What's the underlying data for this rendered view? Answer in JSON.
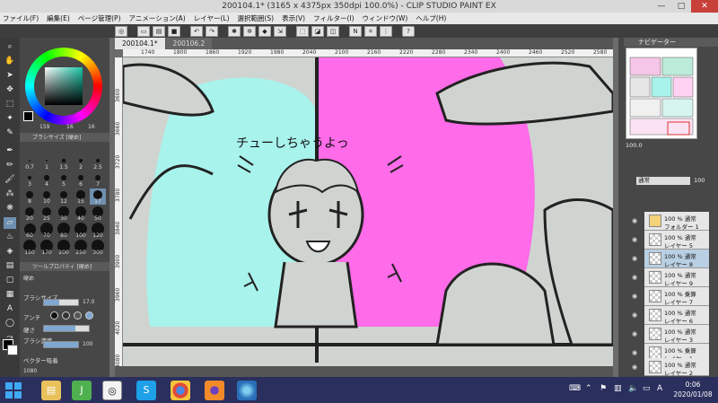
{
  "window": {
    "title": "200104.1* (3165 x 4375px 350dpi 100.0%) - CLIP STUDIO PAINT EX",
    "minimize_label": "—",
    "maximize_label": "□",
    "close_label": "✕"
  },
  "menu": {
    "items": [
      "ファイル(F)",
      "編集(E)",
      "ページ管理(P)",
      "アニメーション(A)",
      "レイヤー(L)",
      "選択範囲(S)",
      "表示(V)",
      "フィルター(I)",
      "ウィンドウ(W)",
      "ヘルプ(H)"
    ]
  },
  "commandbar": {
    "help_label": "?"
  },
  "tabs": [
    {
      "label": "200104.1*"
    },
    {
      "label": "200106.2"
    }
  ],
  "ruler": {
    "h_ticks": [
      "1740",
      "1800",
      "1860",
      "1920",
      "1980",
      "2040",
      "2100",
      "2160",
      "2220",
      "2280",
      "2340",
      "2400",
      "2460",
      "2520",
      "2580"
    ],
    "v_ticks": [
      "3600",
      "3660",
      "3720",
      "3780",
      "3840",
      "3900",
      "3960",
      "4020",
      "4080"
    ]
  },
  "canvas": {
    "speech_text": "チューしちゃうよっ",
    "colors": {
      "left_bg": "#a8f3ec",
      "right_bg": "#ff6be8",
      "panel": "#d0d4d0",
      "ink": "#222222"
    }
  },
  "leftpanel": {
    "color_h_value": "159",
    "color_s_value": "16",
    "color_v_value": "16",
    "brushsize_header": "ブラシサイズ [硬め]",
    "brush_sizes": [
      "0.7",
      "1",
      "1.5",
      "2",
      "2.5",
      "3",
      "4",
      "5",
      "6",
      "7",
      "8",
      "10",
      "12",
      "15",
      "17",
      "20",
      "25",
      "30",
      "40",
      "50",
      "60",
      "70",
      "80",
      "100",
      "120",
      "150",
      "170",
      "200",
      "250",
      "300"
    ],
    "toolprop_header": "ツールプロパティ [硬め]",
    "toolprop_sub": "硬め",
    "props": [
      {
        "label": "ブラシサイズ",
        "value": "17.0"
      },
      {
        "label": "アンチ",
        "value": ""
      },
      {
        "label": "硬さ",
        "value": ""
      },
      {
        "label": "ブラシ濃度",
        "value": "100"
      },
      {
        "label": "ベクター吸着",
        "value": ""
      }
    ],
    "zoom_readout": "1080"
  },
  "rightpanel": {
    "navigator_label": "ナビゲーター",
    "nav_zoom": "100.0",
    "layer_blend": "通常",
    "layer_opacity": "100",
    "layers": [
      {
        "line1": "100 % 通常",
        "line2": "フォルダー 1"
      },
      {
        "line1": "100 % 通常",
        "line2": "レイヤー 5"
      },
      {
        "line1": "100 % 通常",
        "line2": "レイヤー 8"
      },
      {
        "line1": "100 % 通常",
        "line2": "レイヤー 9"
      },
      {
        "line1": "100 % 乗算",
        "line2": "レイヤー 7"
      },
      {
        "line1": "100 % 通常",
        "line2": "レイヤー 6"
      },
      {
        "line1": "100 % 通常",
        "line2": "レイヤー 3"
      },
      {
        "line1": "100 % 乗算",
        "line2": "レイヤー 1"
      },
      {
        "line1": "100 % 通常",
        "line2": "レイヤー 2"
      }
    ]
  },
  "taskbar": {
    "time": "0:06",
    "date": "2020/01/08",
    "ime": "A"
  }
}
